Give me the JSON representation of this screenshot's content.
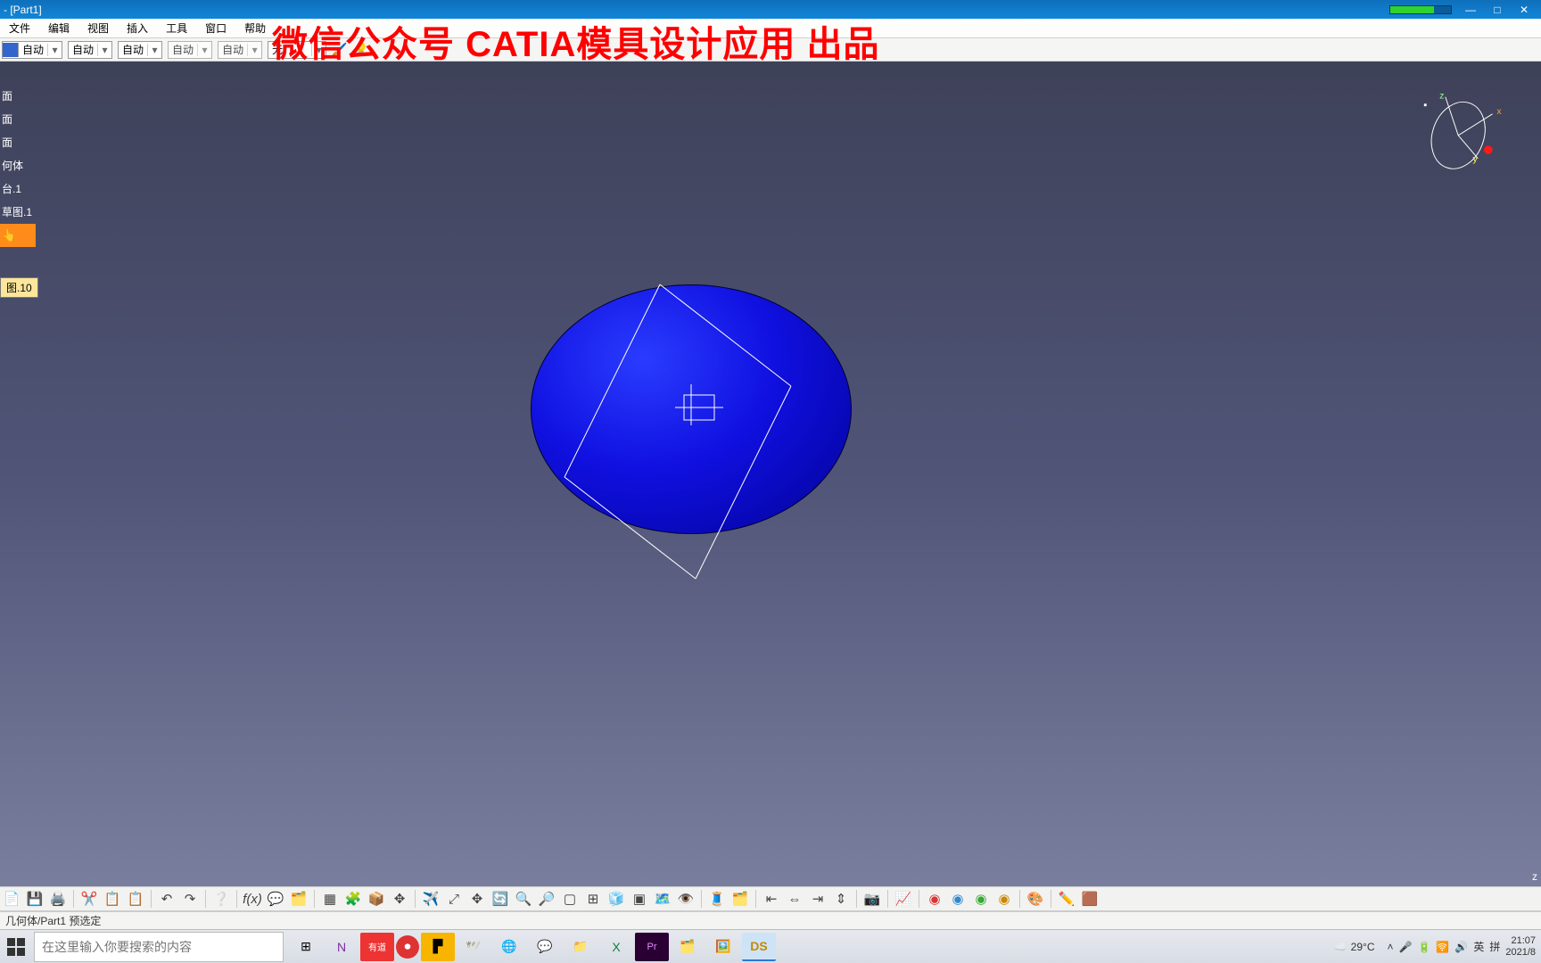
{
  "title_bar": {
    "doc": "- [Part1]"
  },
  "watermark": "微信公众号 CATIA模具设计应用 出品",
  "menus": {
    "file": "文件",
    "edit": "编辑",
    "view": "视图",
    "insert": "插入",
    "tools": "工具",
    "window": "窗口",
    "help": "帮助"
  },
  "opt": {
    "auto": "自动",
    "none": "无"
  },
  "tree": {
    "items": [
      {
        "label": "面"
      },
      {
        "label": "面"
      },
      {
        "label": "面"
      },
      {
        "label": "何体"
      },
      {
        "label": "台.1"
      },
      {
        "label": "草图.1"
      }
    ],
    "sel": "",
    "tooltip": "图.10"
  },
  "axis": {
    "x": "x",
    "y": "y",
    "z": "z"
  },
  "status": "几何体/Part1 预选定",
  "br_corner": "z",
  "taskbar": {
    "search_placeholder": "在这里输入你要搜索的内容",
    "weather": "29°C",
    "ime1": "英",
    "ime2": "拼",
    "time": "21:07",
    "date": "2021/8"
  }
}
